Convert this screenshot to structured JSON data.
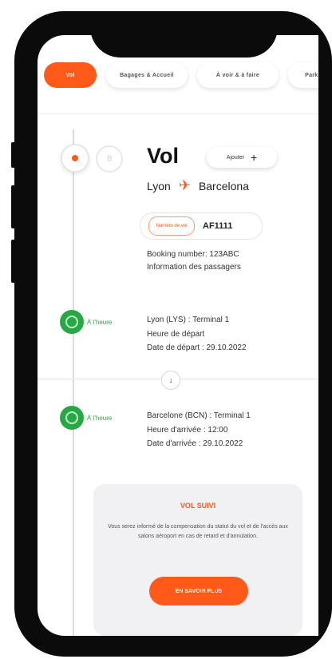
{
  "tabs": [
    {
      "label": "Vol"
    },
    {
      "label": "Bagages & Accueil"
    },
    {
      "label": "À voir & à faire"
    },
    {
      "label": "Parking"
    }
  ],
  "flight": {
    "title": "Vol",
    "add_button": "Ajouter",
    "from": "Lyon",
    "to": "Barcelona",
    "flight_number_label": "Numéro de vol",
    "flight_number": "AF1111",
    "booking_number": "Booking number: 123ABC",
    "passenger_info": "Information des passagers"
  },
  "departure": {
    "status": "À l'heure",
    "terminal": "Lyon (LYS) : Terminal 1",
    "time_label": "Heure de départ",
    "date": "Date de départ : 29.10.2022"
  },
  "arrival": {
    "status": "À l'heure",
    "terminal": "Barcelone (BCN) : Terminal 1",
    "time": "Heure d'arrivée : 12:00",
    "date": "Date d'arrivée : 29.10.2022"
  },
  "followed_card": {
    "title": "VOL SUIVI",
    "body": "Vous serez informé de la compensation du statut du vol et de l'accès aux salons aéroport en cas de retard et d'annulation.",
    "button": "EN SAVOIR PLUS"
  },
  "colors": {
    "accent": "#ff5a1a",
    "on_time": "#28a745"
  }
}
